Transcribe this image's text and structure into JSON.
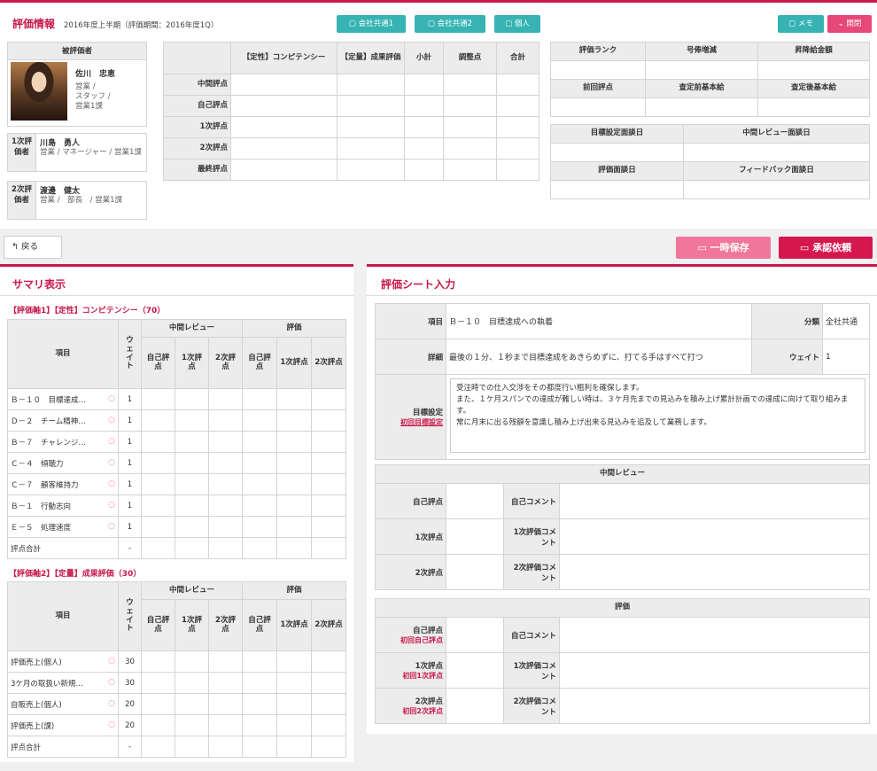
{
  "header": {
    "title": "評価情報",
    "subtitle": "2016年度上半期（評価期間：2016年度1Q）",
    "buttons": {
      "share1": "会社共通1",
      "share2": "会社共通2",
      "personal": "個人",
      "memo": "メモ",
      "toggle": "開閉"
    }
  },
  "evaluatee": {
    "heading": "被評価者",
    "name": "佐川　忠恵",
    "lines": [
      "営業 /",
      "スタッフ /",
      "営業1課"
    ]
  },
  "evaluator1": {
    "label": "1次評価者",
    "name": "川島　勇人",
    "detail": "営業 / マネージャー / 営業1課"
  },
  "evaluator2": {
    "label": "2次評価者",
    "name": "渡邊　健太",
    "detail": "営業 /　部長　/ 営業1課"
  },
  "score_table": {
    "headers": [
      "【定性】コンピテンシー",
      "【定量】成果評価",
      "小計",
      "調整点",
      "合計"
    ],
    "rows": [
      "中間評点",
      "自己評点",
      "1次評点",
      "2次評点",
      "最終評点"
    ]
  },
  "rank_table": {
    "headers1": [
      "評価ランク",
      "号俸増減",
      "昇降給金額"
    ],
    "headers2": [
      "前回評点",
      "査定前基本給",
      "査定後基本給"
    ]
  },
  "date_table": {
    "headers1": [
      "目標設定面談日",
      "中間レビュー面談日"
    ],
    "headers2": [
      "評価面談日",
      "フィードバック面談日"
    ]
  },
  "actions": {
    "back": "戻る",
    "temp_save": "一時保存",
    "approve": "承認依頼"
  },
  "summary": {
    "title": "サマリ表示",
    "col_groups": [
      "中間レビュー",
      "評価"
    ],
    "col_item": "項目",
    "col_weight": "ウェイト",
    "sub_cols": [
      "自己評点",
      "1次評点",
      "2次評点"
    ],
    "axis1": {
      "title": "【評価軸1】【定性】コンピテンシー（70）",
      "rows": [
        {
          "name": "Ｂ－１０　目標達成…",
          "w": "1"
        },
        {
          "name": "Ｄ－２　チーム精神…",
          "w": "1"
        },
        {
          "name": "Ｂ－７　チャレンジ…",
          "w": "1"
        },
        {
          "name": "Ｃ－４　傾聴力",
          "w": "1"
        },
        {
          "name": "Ｃ－７　顧客維持力",
          "w": "1"
        },
        {
          "name": "Ｂ－１　行動志向",
          "w": "1"
        },
        {
          "name": "Ｅ－５　処理速度",
          "w": "1"
        }
      ],
      "total_label": "評点合計",
      "total_w": "-"
    },
    "axis2": {
      "title": "【評価軸2】【定量】成果評価（30）",
      "rows": [
        {
          "name": "評価売上(個人)",
          "w": "30"
        },
        {
          "name": "3ケ月の取扱い新規…",
          "w": "30"
        },
        {
          "name": "自販売上(個人)",
          "w": "20"
        },
        {
          "name": "評価売上(課)",
          "w": "20"
        }
      ],
      "total_label": "評点合計",
      "total_w": "-"
    }
  },
  "sheet": {
    "title": "評価シート入力",
    "item_label": "項目",
    "item_value": "Ｂ－１０　目標達成への執着",
    "category_label": "分類",
    "category_value": "全社共通",
    "detail_label": "詳細",
    "detail_value": "最後の１分、１秒まで目標達成をあきらめずに、打てる手はすべて打つ",
    "weight_label": "ウェイト",
    "weight_value": "1",
    "goal_label": "目標設定",
    "goal_link": "初回目標設定",
    "goal_text": "受注時での仕入交渉をその都度行い粗利を確保します。\nまた、１ケ月スパンでの達成が難しい時は、３ケ月先までの見込みを積み上げ累計計画での達成に向けて取り組みます。\n常に月末に出る残額を意識し積み上げ出来る見込みを追及して業務します。",
    "mid": {
      "title": "中間レビュー",
      "rows": [
        {
          "label": "自己評点",
          "comment": "自己コメント"
        },
        {
          "label": "1次評点",
          "comment": "1次評価コメント"
        },
        {
          "label": "2次評点",
          "comment": "2次評価コメント"
        }
      ]
    },
    "eval": {
      "title": "評価",
      "rows": [
        {
          "label": "自己評点",
          "link": "初回自己評点",
          "comment": "自己コメント"
        },
        {
          "label": "1次評点",
          "link": "初回1次評点",
          "comment": "1次評価コメント"
        },
        {
          "label": "2次評点",
          "link": "初回2次評点",
          "comment": "2次評価コメント"
        }
      ]
    }
  },
  "colors": {
    "accent": "#c8184a",
    "teal": "#37b3b3",
    "pink": "#e8477a"
  }
}
